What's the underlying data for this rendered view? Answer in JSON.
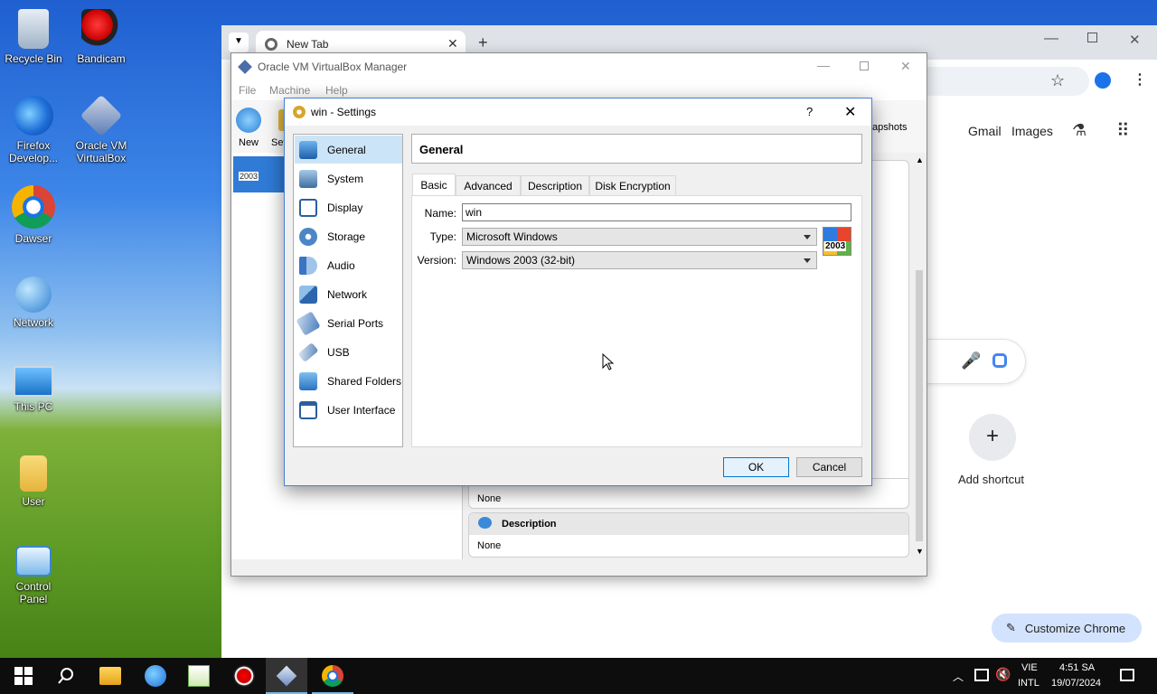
{
  "desktop": {
    "icons": [
      {
        "label": "Recycle Bin",
        "icon": "recycle-bin-icon"
      },
      {
        "label": "Bandicam",
        "icon": "bandicam-icon"
      },
      {
        "label": "Firefox Develop...",
        "icon": "firefox-dev-icon"
      },
      {
        "label": "Oracle VM VirtualBox",
        "icon": "virtualbox-icon"
      },
      {
        "label": "Dawser",
        "icon": "chrome-icon"
      },
      {
        "label": "Network",
        "icon": "network-icon"
      },
      {
        "label": "This PC",
        "icon": "this-pc-icon"
      },
      {
        "label": "User",
        "icon": "user-folder-icon"
      },
      {
        "label": "Control Panel",
        "icon": "control-panel-icon"
      }
    ]
  },
  "chrome": {
    "tab_title": "New Tab",
    "links": {
      "gmail": "Gmail",
      "images": "Images"
    },
    "add_shortcut": "Add shortcut",
    "customize": "Customize Chrome",
    "accent": "#1a73e8"
  },
  "vbox": {
    "title": "Oracle VM VirtualBox Manager",
    "menu": [
      "File",
      "Machine",
      "Help"
    ],
    "toolbar": {
      "new": "New",
      "settings": "Set",
      "snapshots": "apshots"
    },
    "vm_item_os": "2003",
    "details": {
      "none_1": "None",
      "description_header": "Description",
      "none_2": "None"
    }
  },
  "dialog": {
    "title": "win - Settings",
    "help": "?",
    "section_header": "General",
    "nav": [
      {
        "label": "General",
        "icon": "general-icon"
      },
      {
        "label": "System",
        "icon": "system-icon"
      },
      {
        "label": "Display",
        "icon": "display-icon"
      },
      {
        "label": "Storage",
        "icon": "storage-icon"
      },
      {
        "label": "Audio",
        "icon": "audio-icon"
      },
      {
        "label": "Network",
        "icon": "network-icon"
      },
      {
        "label": "Serial Ports",
        "icon": "serial-ports-icon"
      },
      {
        "label": "USB",
        "icon": "usb-icon"
      },
      {
        "label": "Shared Folders",
        "icon": "shared-folders-icon"
      },
      {
        "label": "User Interface",
        "icon": "user-interface-icon"
      }
    ],
    "tabs": [
      "Basic",
      "Advanced",
      "Description",
      "Disk Encryption"
    ],
    "form": {
      "name_label": "Name:",
      "name_value": "win",
      "type_label": "Type:",
      "type_value": "Microsoft Windows",
      "version_label": "Version:",
      "version_value": "Windows 2003 (32-bit)",
      "os_badge": "2003"
    },
    "ok": "OK",
    "cancel": "Cancel"
  },
  "taskbar": {
    "lang_top": "VIE",
    "lang_bottom": "INTL",
    "time": "4:51 SA",
    "date": "19/07/2024"
  }
}
